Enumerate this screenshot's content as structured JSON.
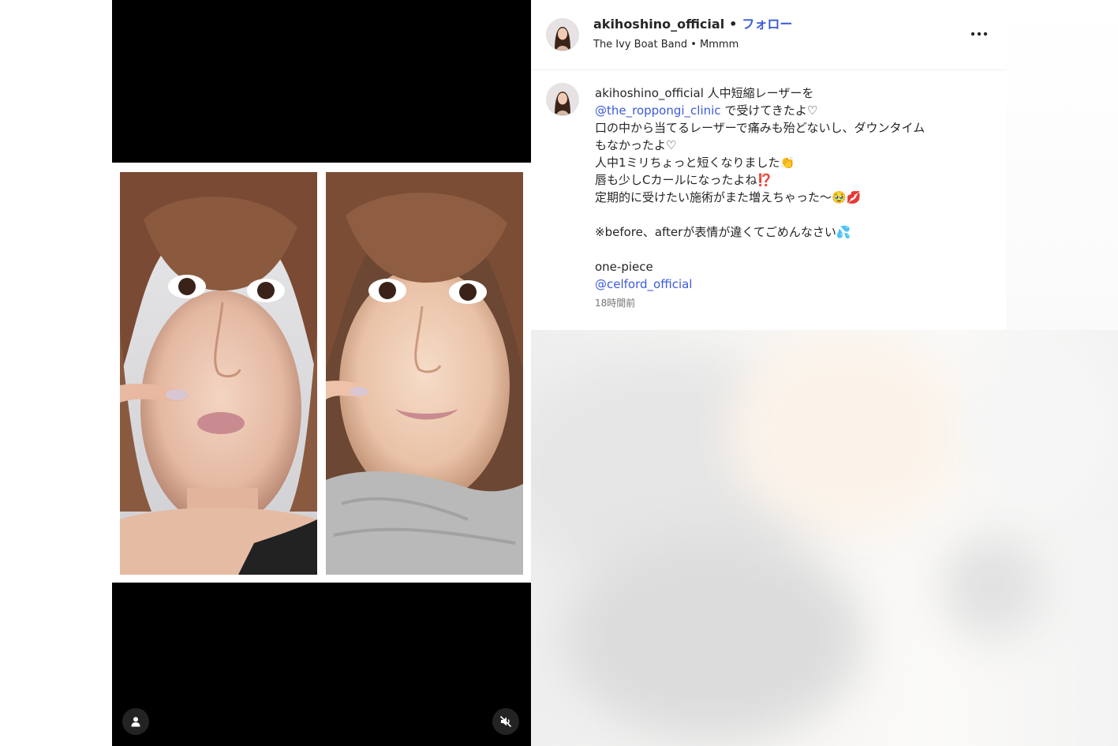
{
  "post": {
    "header": {
      "username": "akihoshino_official",
      "separator": "•",
      "follow_label": "フォロー",
      "subtitle": "The Ivy Boat Band • Mmmm",
      "more_label": "•••"
    },
    "caption": {
      "username": "akihoshino_official",
      "lines": [
        "人中短縮レーザーを",
        "@the_roppongi_clinic",
        "で受けてきたよ♡",
        "口の中から当てるレーザーで痛みも殆どないし、ダウンタイム",
        "もなかったよ♡",
        "人中1ミリちょっと短くなりました👏",
        "唇も少しCカールになったよね⁉️",
        "定期的に受けたい施術がまた増えちゃった〜🥹💋",
        "※before、afterが表情が違くてごめんなさい💦",
        "one-piece",
        "@celford_official"
      ],
      "timestamp": "18時間前"
    }
  },
  "icons": {
    "user_tag": "person-icon",
    "mute": "speaker-muted-icon",
    "more": "more-horizontal-icon"
  },
  "colors": {
    "link": "#3b5bdb",
    "text": "#262626",
    "muted": "#737373",
    "media_background": "#000000"
  }
}
